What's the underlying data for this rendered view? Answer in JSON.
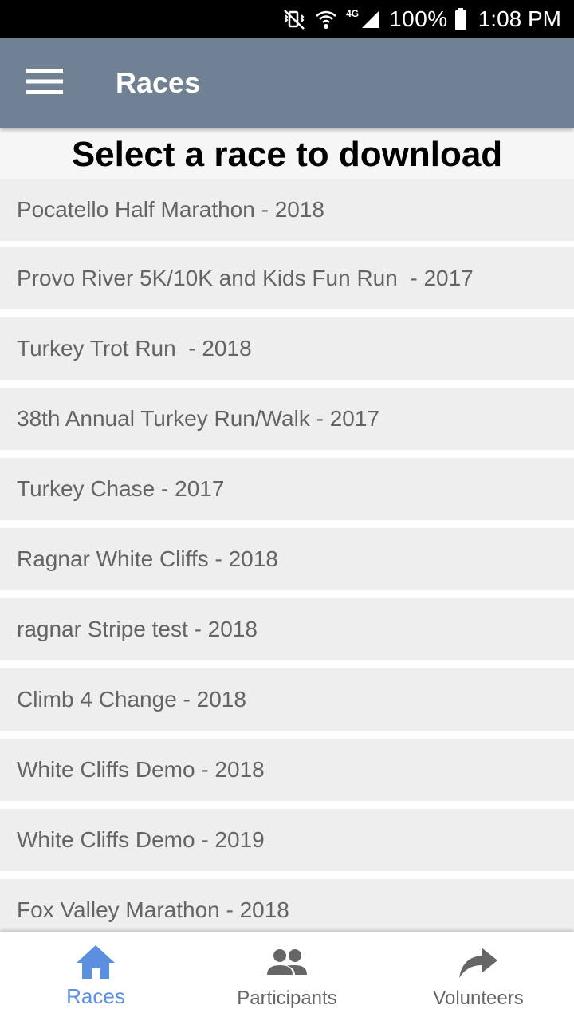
{
  "status_bar": {
    "battery_text": "100%",
    "time": "1:08 PM",
    "network_label": "4G"
  },
  "app_bar": {
    "title": "Races",
    "menu_icon": "hamburger-menu-icon"
  },
  "page": {
    "heading": "Select a race to download"
  },
  "races": [
    {
      "label": "Pocatello Half Marathon - 2018"
    },
    {
      "label": "Provo River 5K/10K and Kids Fun Run  - 2017"
    },
    {
      "label": "Turkey Trot Run  - 2018"
    },
    {
      "label": "38th Annual Turkey Run/Walk - 2017"
    },
    {
      "label": "Turkey Chase - 2017"
    },
    {
      "label": "Ragnar White Cliffs - 2018"
    },
    {
      "label": "ragnar Stripe test - 2018"
    },
    {
      "label": "Climb 4 Change - 2018"
    },
    {
      "label": "White Cliffs Demo - 2018"
    },
    {
      "label": "White Cliffs Demo - 2019"
    },
    {
      "label": "Fox Valley Marathon - 2018"
    }
  ],
  "bottom_nav": {
    "tabs": [
      {
        "label": "Races",
        "icon": "home-icon",
        "active": true
      },
      {
        "label": "Participants",
        "icon": "people-icon",
        "active": false
      },
      {
        "label": "Volunteers",
        "icon": "share-arrow-icon",
        "active": false
      }
    ]
  },
  "colors": {
    "app_bar": "#6f8193",
    "list_item_bg": "#eeeeee",
    "list_text": "#646464",
    "active_tab": "#5b8fe0",
    "inactive_tab": "#666666"
  }
}
